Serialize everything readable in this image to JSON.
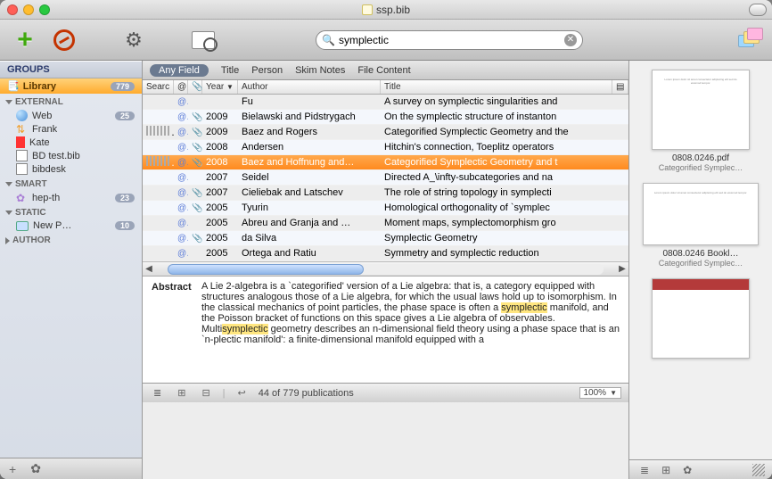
{
  "window": {
    "title": "ssp.bib"
  },
  "toolbar": {
    "search_value": "symplectic",
    "search_placeholder": "Search"
  },
  "scope": {
    "items": [
      "Any Field",
      "Title",
      "Person",
      "Skim Notes",
      "File Content"
    ],
    "active": 0
  },
  "sidebar": {
    "header": "GROUPS",
    "library": {
      "label": "Library",
      "count": "779"
    },
    "groups": [
      {
        "name": "EXTERNAL",
        "expanded": true,
        "items": [
          {
            "label": "Web",
            "icon": "globe",
            "count": "25"
          },
          {
            "label": "Frank",
            "icon": "arrows"
          },
          {
            "label": "Kate",
            "icon": "bookmark"
          },
          {
            "label": "BD test.bib",
            "icon": "doc"
          },
          {
            "label": "bibdesk",
            "icon": "doc"
          }
        ]
      },
      {
        "name": "SMART",
        "expanded": true,
        "items": [
          {
            "label": "hep-th",
            "icon": "gear",
            "count": "23"
          }
        ]
      },
      {
        "name": "STATIC",
        "expanded": true,
        "items": [
          {
            "label": "New P…",
            "icon": "folder",
            "count": "10"
          }
        ]
      },
      {
        "name": "AUTHOR",
        "expanded": false,
        "items": []
      }
    ]
  },
  "table": {
    "columns": {
      "search": "Searc",
      "at": "@",
      "clip": "",
      "year": "Year",
      "author": "Author",
      "title": "Title"
    },
    "rows": [
      {
        "at": true,
        "clip": false,
        "year": "",
        "author": "Fu",
        "title": "A survey on symplectic singularities and",
        "bars": false
      },
      {
        "at": true,
        "clip": true,
        "year": "2009",
        "author": "Bielawski and Pidstrygach",
        "title": "On the symplectic structure of instanton",
        "bars": false
      },
      {
        "at": true,
        "clip": true,
        "year": "2009",
        "author": "Baez and Rogers",
        "title": "Categorified Symplectic Geometry and the",
        "bars": true
      },
      {
        "at": true,
        "clip": true,
        "year": "2008",
        "author": "Andersen",
        "title": "Hitchin's connection, Toeplitz operators",
        "bars": false
      },
      {
        "at": true,
        "clip": true,
        "year": "2008",
        "author": "Baez and Hoffnung and…",
        "title": "Categorified Symplectic Geometry and t",
        "bars": true,
        "selected": true
      },
      {
        "at": true,
        "clip": false,
        "year": "2007",
        "author": "Seidel",
        "title": "Directed A_\\infty-subcategories and na",
        "bars": false
      },
      {
        "at": true,
        "clip": true,
        "year": "2007",
        "author": "Cieliebak and Latschev",
        "title": "The role of string topology in symplecti",
        "bars": false
      },
      {
        "at": true,
        "clip": true,
        "year": "2005",
        "author": "Tyurin",
        "title": "Homological orthogonality of `symplec",
        "bars": false
      },
      {
        "at": true,
        "clip": false,
        "year": "2005",
        "author": "Abreu and Granja and …",
        "title": "Moment maps, symplectomorphism gro",
        "bars": false
      },
      {
        "at": true,
        "clip": true,
        "year": "2005",
        "author": "da Silva",
        "title": "Symplectic Geometry",
        "bars": false
      },
      {
        "at": true,
        "clip": false,
        "year": "2005",
        "author": "Ortega and Ratiu",
        "title": "Symmetry and symplectic reduction",
        "bars": false
      }
    ]
  },
  "abstract": {
    "label": "Abstract",
    "text_before": "A Lie 2-algebra is a `categorified' version of a Lie algebra: that is, a category equipped with structures analogous those of a Lie algebra, for which the usual laws hold up to isomorphism. In the classical mechanics of point particles, the phase space is often a ",
    "hl1": "symplectic",
    "text_mid": " manifold, and the Poisson bracket of functions on this space gives a Lie algebra of observables. Multi",
    "hl2": "symplectic",
    "text_after": " geometry describes an n-dimensional field theory using a phase space that is an `n-plectic manifold': a finite-dimensional manifold equipped with a"
  },
  "status": {
    "count": "44 of 779 publications",
    "zoom": "100%"
  },
  "preview": {
    "items": [
      {
        "title": "0808.0246.pdf",
        "sub": "Categorified Symplec…",
        "kind": "page"
      },
      {
        "title": "0808.0246 Bookl…",
        "sub": "Categorified Symplec…",
        "kind": "wide"
      },
      {
        "title": "",
        "sub": "",
        "kind": "color"
      }
    ]
  }
}
